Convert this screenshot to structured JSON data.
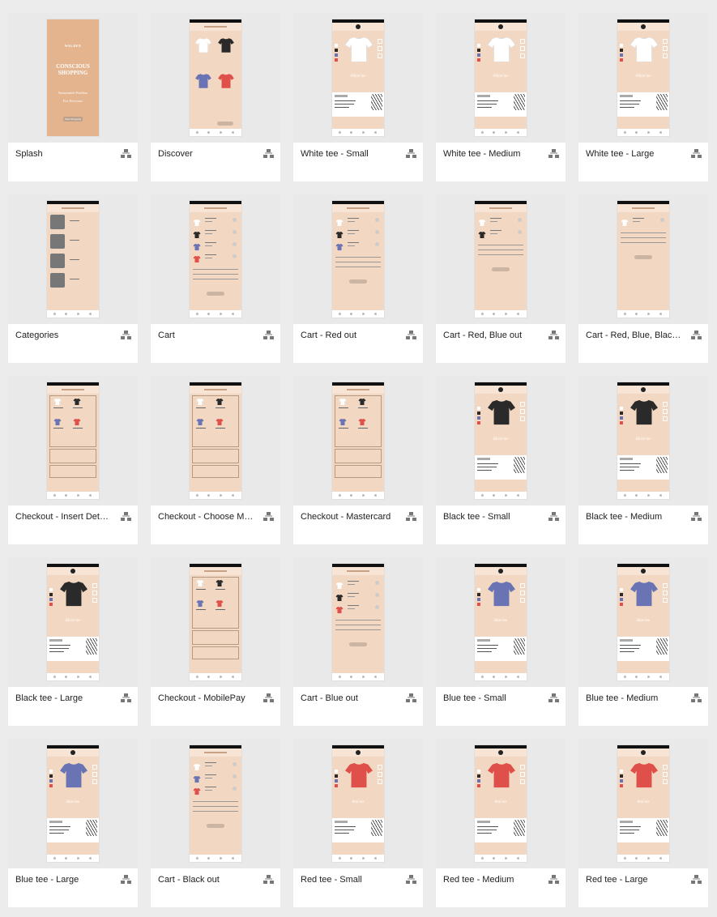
{
  "colors": {
    "white": "#ffffff",
    "black": "#2a2a2a",
    "blue": "#6a73b3",
    "red": "#e0504b",
    "peach": "#f2d8c2",
    "splash": "#e3b48e"
  },
  "splash": {
    "brand": "WALDEN",
    "title_line1": "CONSCIOUS",
    "title_line2": "SHOPPING",
    "subtitle_line1": "Sustainable Fashion",
    "subtitle_line2": "For Everyone",
    "button": "Start Shopping"
  },
  "product_names": {
    "white": "White tee",
    "black": "Black tee",
    "blue": "Blue tee",
    "red": "Red tee"
  },
  "artboards": [
    {
      "title": "Splash",
      "kind": "splash"
    },
    {
      "title": "Discover",
      "kind": "discover"
    },
    {
      "title": "White tee - Small",
      "kind": "product",
      "color": "white"
    },
    {
      "title": "White tee - Medium",
      "kind": "product",
      "color": "white"
    },
    {
      "title": "White tee - Large",
      "kind": "product",
      "color": "white"
    },
    {
      "title": "Categories",
      "kind": "categories"
    },
    {
      "title": "Cart",
      "kind": "cart",
      "items": [
        "white",
        "black",
        "blue",
        "red"
      ]
    },
    {
      "title": "Cart - Red out",
      "kind": "cart",
      "items": [
        "white",
        "black",
        "blue"
      ]
    },
    {
      "title": "Cart - Red, Blue out",
      "kind": "cart",
      "items": [
        "white",
        "black"
      ]
    },
    {
      "title": "Cart - Red, Blue, Black out",
      "kind": "cart",
      "items": [
        "white"
      ]
    },
    {
      "title": "Checkout - Insert Details",
      "kind": "checkout"
    },
    {
      "title": "Checkout - Choose Method",
      "kind": "checkout"
    },
    {
      "title": "Checkout - Mastercard",
      "kind": "checkout"
    },
    {
      "title": "Black tee - Small",
      "kind": "product",
      "color": "black"
    },
    {
      "title": "Black tee - Medium",
      "kind": "product",
      "color": "black"
    },
    {
      "title": "Black tee - Large",
      "kind": "product",
      "color": "black"
    },
    {
      "title": "Checkout - MobilePay",
      "kind": "checkout"
    },
    {
      "title": "Cart - Blue out",
      "kind": "cart",
      "items": [
        "white",
        "black",
        "red"
      ]
    },
    {
      "title": "Blue tee - Small",
      "kind": "product",
      "color": "blue"
    },
    {
      "title": "Blue tee - Medium",
      "kind": "product",
      "color": "blue"
    },
    {
      "title": "Blue tee - Large",
      "kind": "product",
      "color": "blue"
    },
    {
      "title": "Cart - Black out",
      "kind": "cart",
      "items": [
        "white",
        "blue",
        "red"
      ]
    },
    {
      "title": "Red tee - Small",
      "kind": "product",
      "color": "red"
    },
    {
      "title": "Red tee - Medium",
      "kind": "product",
      "color": "red"
    },
    {
      "title": "Red tee - Large",
      "kind": "product",
      "color": "red"
    }
  ],
  "icons": {
    "flow": "flow-hierarchy-icon",
    "tshirt": "tshirt-icon"
  }
}
